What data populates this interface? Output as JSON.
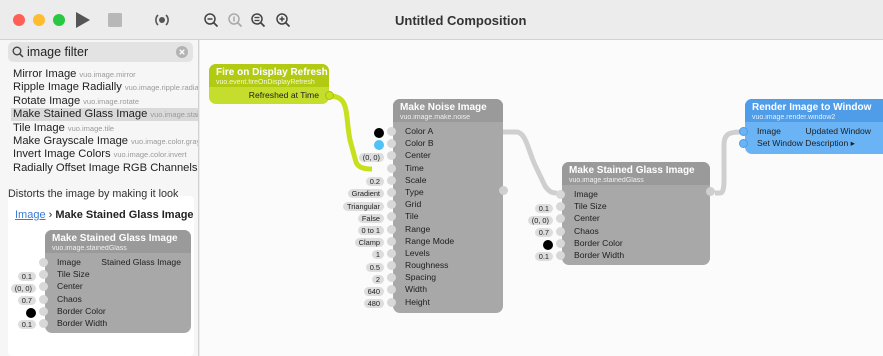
{
  "window": {
    "title": "Untitled Composition"
  },
  "colors": {
    "close": "#ff5f57",
    "minimize": "#febc2e",
    "zoom": "#28c840",
    "event_node": "#b2d40e",
    "render_node": "#5aa8f0",
    "node_gray": "#a8a8a8"
  },
  "toolbar": {
    "icons": [
      "run-icon",
      "stop-icon",
      "broadcast-icon",
      "zoom-out-icon",
      "actual-size-icon",
      "zoom-to-fit-icon",
      "zoom-in-icon"
    ]
  },
  "sidebar": {
    "search": {
      "value": "image filter"
    },
    "results": [
      {
        "name": "Mirror Image",
        "id": "vuo.image.mirror"
      },
      {
        "name": "Ripple Image Radially",
        "id": "vuo.image.ripple.radial"
      },
      {
        "name": "Rotate Image",
        "id": "vuo.image.rotate"
      },
      {
        "name": "Make Stained Glass Image",
        "id": "vuo.image.stainedGlass"
      },
      {
        "name": "Tile Image",
        "id": "vuo.image.tile"
      },
      {
        "name": "Make Grayscale Image",
        "id": "vuo.image.color.gray"
      },
      {
        "name": "Invert Image Colors",
        "id": "vuo.image.color.invert"
      },
      {
        "name": "Radially Offset Image RGB Channels",
        "id": "vuo.image.color.offset.radial"
      }
    ],
    "detail": {
      "breadcrumb_link": "Image",
      "breadcrumb_sep": " › ",
      "breadcrumb_title": "Make Stained Glass Image",
      "description": "Distorts the image by making it look"
    }
  },
  "nodes": {
    "fire": {
      "title": "Fire on Display Refresh",
      "subtitle": "vuo.event.fireOnDisplayRefresh",
      "output": "Refreshed at Time"
    },
    "noise": {
      "title": "Make Noise Image",
      "subtitle": "vuo.image.make.noise",
      "ports": [
        {
          "name": "Color A",
          "color": "#000000"
        },
        {
          "name": "Color B",
          "color": "#4fc3f7"
        },
        {
          "name": "Center",
          "value": "(0, 0)"
        },
        {
          "name": "Time"
        },
        {
          "name": "Scale",
          "value": "0.2"
        },
        {
          "name": "Type",
          "value": "Gradient"
        },
        {
          "name": "Grid",
          "value": "Triangular"
        },
        {
          "name": "Tile",
          "value": "False"
        },
        {
          "name": "Range",
          "value": "0 to 1"
        },
        {
          "name": "Range Mode",
          "value": "Clamp"
        },
        {
          "name": "Levels",
          "value": "1"
        },
        {
          "name": "Roughness",
          "value": "0.5"
        },
        {
          "name": "Spacing",
          "value": "2"
        },
        {
          "name": "Width",
          "value": "640"
        },
        {
          "name": "Height",
          "value": "480"
        }
      ]
    },
    "stained": {
      "title": "Make Stained Glass Image",
      "subtitle": "vuo.image.stainedGlass",
      "output": "Stained Glass Image",
      "ports": [
        {
          "name": "Image"
        },
        {
          "name": "Tile Size",
          "value": "0.1"
        },
        {
          "name": "Center",
          "value": "(0, 0)"
        },
        {
          "name": "Chaos",
          "value": "0.7"
        },
        {
          "name": "Border Color",
          "color": "#000000"
        },
        {
          "name": "Border Width",
          "value": "0.1"
        }
      ]
    },
    "render": {
      "title": "Render Image to Window",
      "subtitle": "vuo.image.render.window2",
      "output": "Updated Window",
      "ports": [
        {
          "name": "Image"
        },
        {
          "name": "Set Window Description ▸"
        }
      ]
    }
  }
}
